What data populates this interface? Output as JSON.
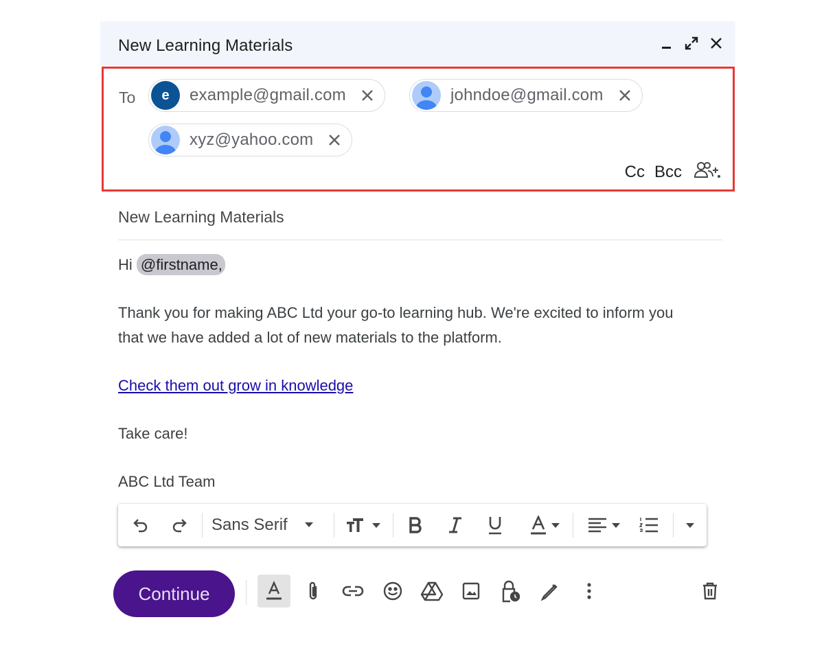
{
  "window": {
    "title": "New Learning Materials"
  },
  "recipients": {
    "to_label": "To",
    "chips": [
      {
        "email": "example@gmail.com",
        "avatar_letter": "e"
      },
      {
        "email": "johndoe@gmail.com"
      },
      {
        "email": "xyz@yahoo.com"
      }
    ],
    "cc_label": "Cc",
    "bcc_label": "Bcc"
  },
  "subject": "New Learning Materials",
  "body": {
    "greeting": "Hi",
    "mention": "@firstname,",
    "paragraph_line1": "Thank you for making ABC Ltd your go-to learning hub. We're excited to inform you",
    "paragraph_line2": "that we have added a lot of new materials to the platform.",
    "link_text": "Check them out grow in knowledge",
    "closing": "Take care!",
    "signature": "ABC Ltd Team"
  },
  "format_bar": {
    "font_name": "Sans Serif"
  },
  "send_button": {
    "label": "Continue"
  },
  "colors": {
    "send_button": "#4a148c",
    "highlight_border": "#e53935",
    "avatar_letter_bg": "#0b5394",
    "link": "#1a0dab"
  }
}
